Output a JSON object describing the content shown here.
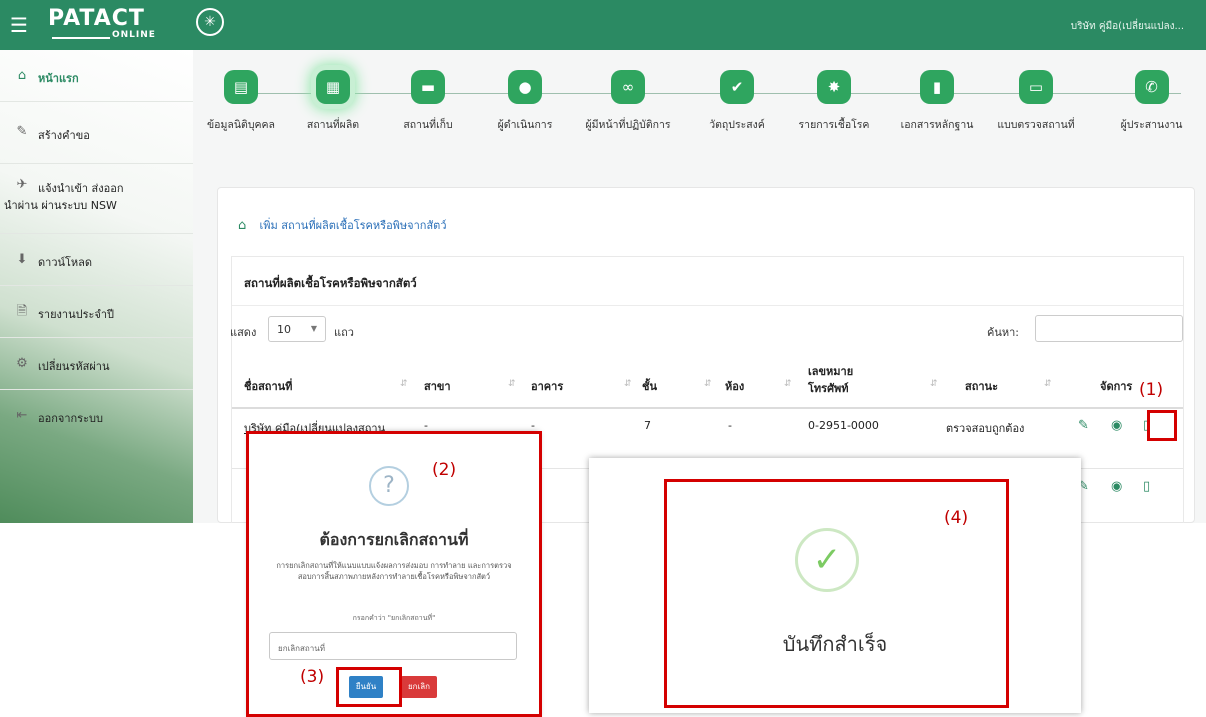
{
  "header": {
    "logo_text": "PATACT",
    "logo_sub": "ONLINE",
    "user_name": "บริษัท คู่มือ(เปลี่ยนแปลง..."
  },
  "sidebar": {
    "items": [
      {
        "label": "หน้าแรก",
        "icon": "home-icon"
      },
      {
        "label": "สร้างคำขอ",
        "icon": "pencil-icon"
      },
      {
        "label_line1": "แจ้งนำเข้า ส่งออก",
        "label_line2": "นำผ่าน ผ่านระบบ NSW",
        "icon": "plane-icon"
      },
      {
        "label": "ดาวน์โหลด",
        "icon": "download-icon"
      },
      {
        "label": "รายงานประจำปี",
        "icon": "file-icon"
      },
      {
        "label": "เปลี่ยนรหัสผ่าน",
        "icon": "gears-icon"
      },
      {
        "label": "ออกจากระบบ",
        "icon": "logout-icon"
      }
    ]
  },
  "steps": [
    {
      "label": "ข้อมูลนิติบุคคล",
      "icon": "id-card-icon"
    },
    {
      "label": "สถานที่ผลิต",
      "icon": "building-icon"
    },
    {
      "label": "สถานที่เก็บ",
      "icon": "archive-icon"
    },
    {
      "label": "ผู้ดำเนินการ",
      "icon": "user-icon"
    },
    {
      "label": "ผู้มีหน้าที่ปฏิบัติการ",
      "icon": "users-icon"
    },
    {
      "label": "วัตถุประสงค์",
      "icon": "check-square-icon"
    },
    {
      "label": "รายการเชื้อโรค",
      "icon": "virus-icon"
    },
    {
      "label": "เอกสารหลักฐาน",
      "icon": "document-icon"
    },
    {
      "label": "แบบตรวจสถานที่",
      "icon": "clipboard-icon"
    },
    {
      "label": "ผู้ประสานงาน",
      "icon": "phone-icon"
    }
  ],
  "main": {
    "add_link": "เพิ่ม สถานที่ผลิตเชื้อโรคหรือพิษจากสัตว์",
    "table_title": "สถานที่ผลิตเชื้อโรคหรือพิษจากสัตว์",
    "show_label": "แสดง",
    "page_size": "10",
    "rows_label": "แถว",
    "search_label": "ค้นหา:",
    "columns": {
      "name": "ชื่อสถานที่",
      "branch": "สาขา",
      "building": "อาคาร",
      "floor": "ชั้น",
      "room": "ห้อง",
      "phone_l1": "เลขหมาย",
      "phone_l2": "โทรศัพท์",
      "status": "สถานะ",
      "actions": "จัดการ"
    },
    "rows": [
      {
        "name": "บริษัท คู่มือ(เปลี่ยนแปลงสถาน",
        "branch": "-",
        "building": "-",
        "floor": "7",
        "room": "-",
        "phone": "0-2951-0000",
        "status": "ตรวจสอบถูกต้อง"
      }
    ]
  },
  "markers": {
    "m1": "(1)",
    "m2": "(2)",
    "m3": "(3)",
    "m4": "(4)"
  },
  "cancel_dialog": {
    "icon": "question-icon",
    "title": "ต้องการยกเลิกสถานที่",
    "desc": "การยกเลิกสถานที่ให้แนบแบบแจ้งผลการส่งมอบ การทำลาย และการตรวจสอบการสิ้นสภาพภายหลังการทำลายเชื้อโรคหรือพิษจากสัตว์",
    "prompt": "กรอกคำว่า \"ยกเลิกสถานที่\"",
    "input_value": "ยกเลิกสถานที่",
    "confirm_label": "ยืนยัน",
    "cancel_label": "ยกเลิก"
  },
  "success_dialog": {
    "icon": "check-icon",
    "text": "บันทึกสำเร็จ"
  },
  "colors": {
    "brand_green": "#2b8a63",
    "step_green": "#2fa55f",
    "marker_red": "#d40000",
    "confirm_blue": "#2f81c6",
    "cancel_red": "#d93a3a"
  }
}
